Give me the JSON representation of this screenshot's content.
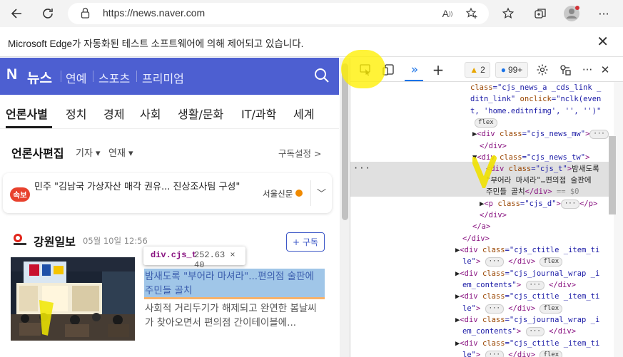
{
  "browser": {
    "url": "https://news.naver.com",
    "read_aloud_label": "A",
    "infobar_text": "Microsoft Edge가 자동화된 테스트 소프트웨어에 의해 제어되고 있습니다."
  },
  "naver": {
    "logo": "N",
    "brand": "뉴스",
    "topnav": [
      "연예",
      "스포츠",
      "프리미엄"
    ],
    "tabs": [
      "언론사별",
      "정치",
      "경제",
      "사회",
      "생활/문화",
      "IT/과학",
      "세계"
    ],
    "edit_title": "언론사편집",
    "filter1": "기자",
    "filter2": "연재",
    "subscribe_settings": "구독설정 >",
    "breaking": {
      "badge": "속보",
      "text": "민주 \"김남국 가상자산 매각 권유... 진상조사팀 구성\"",
      "source": "서울신문"
    },
    "press": {
      "name": "강원일보",
      "time": "05월 10일 12:56",
      "subscribe": "+ 구독",
      "headline": "밤새도록 \"부어라 마셔라\"...편의점 술판에 주민들 골치",
      "summary": "사회적 거리두기가 해제되고 완연한 봄날씨가 찾아오면서 편의점 간이테이블에..."
    },
    "tooltip": {
      "name": "div.cjs_t",
      "size": "252.63 × 40"
    }
  },
  "devtools": {
    "warnings": "2",
    "messages": "99+",
    "dots": "···"
  }
}
